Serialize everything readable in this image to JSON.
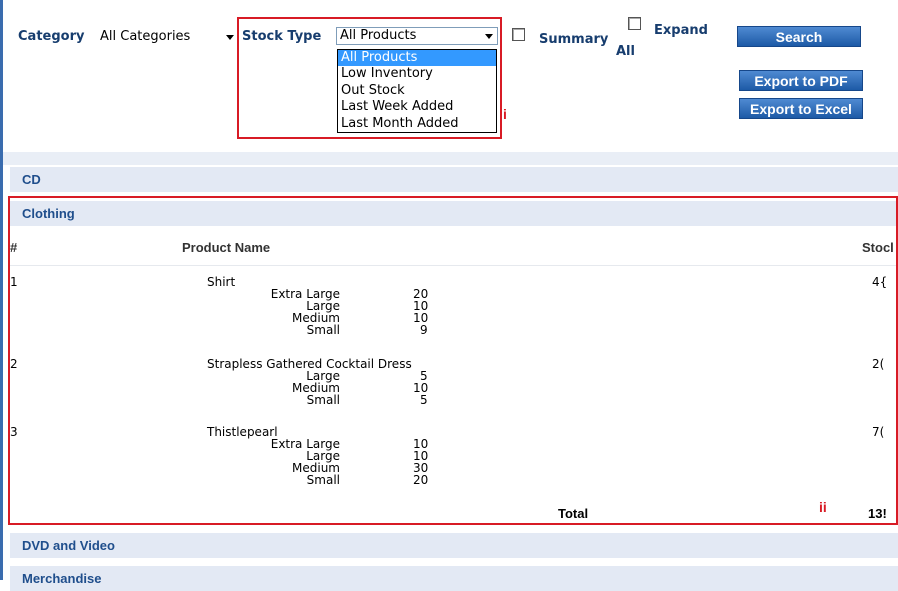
{
  "filters": {
    "category_label": "Category",
    "category_value": "All Categories",
    "stock_type_label": "Stock Type",
    "stock_type_value": "All Products",
    "stock_type_options": [
      "All Products",
      "Low Inventory",
      "Out Stock",
      "Last Week Added",
      "Last Month Added"
    ],
    "summary_label": "Summary",
    "expand_all_label_1": "Expand",
    "expand_all_label_2": "All",
    "search_button": "Search",
    "export_pdf_button": "Export to PDF",
    "export_excel_button": "Export to Excel"
  },
  "annotations": {
    "label_i": "i",
    "label_ii": "ii"
  },
  "categories": [
    {
      "name": "CD"
    },
    {
      "name": "Clothing",
      "columns": {
        "num": "#",
        "product": "Product Name",
        "stock": "Stocl"
      },
      "products": [
        {
          "num": "1",
          "name": "Shirt",
          "stock": "4{",
          "variants": [
            {
              "size": "Extra Large",
              "qty": "20"
            },
            {
              "size": "Large",
              "qty": "10"
            },
            {
              "size": "Medium",
              "qty": "10"
            },
            {
              "size": "Small",
              "qty": "9"
            }
          ]
        },
        {
          "num": "2",
          "name": "Strapless Gathered Cocktail Dress",
          "stock": "2(",
          "variants": [
            {
              "size": "Large",
              "qty": "5"
            },
            {
              "size": "Medium",
              "qty": "10"
            },
            {
              "size": "Small",
              "qty": "5"
            }
          ]
        },
        {
          "num": "3",
          "name": "Thistlepearl",
          "stock": "7(",
          "variants": [
            {
              "size": "Extra Large",
              "qty": "10"
            },
            {
              "size": "Large",
              "qty": "10"
            },
            {
              "size": "Medium",
              "qty": "30"
            },
            {
              "size": "Small",
              "qty": "20"
            }
          ]
        }
      ],
      "total_label": "Total",
      "total_value": "13!"
    },
    {
      "name": "DVD and Video"
    },
    {
      "name": "Merchandise"
    }
  ],
  "colors": {
    "accent": "#1d5aa6",
    "annotation_red": "#d81b25",
    "category_bar": "#e3e9f4",
    "label_blue": "#173d6e"
  }
}
